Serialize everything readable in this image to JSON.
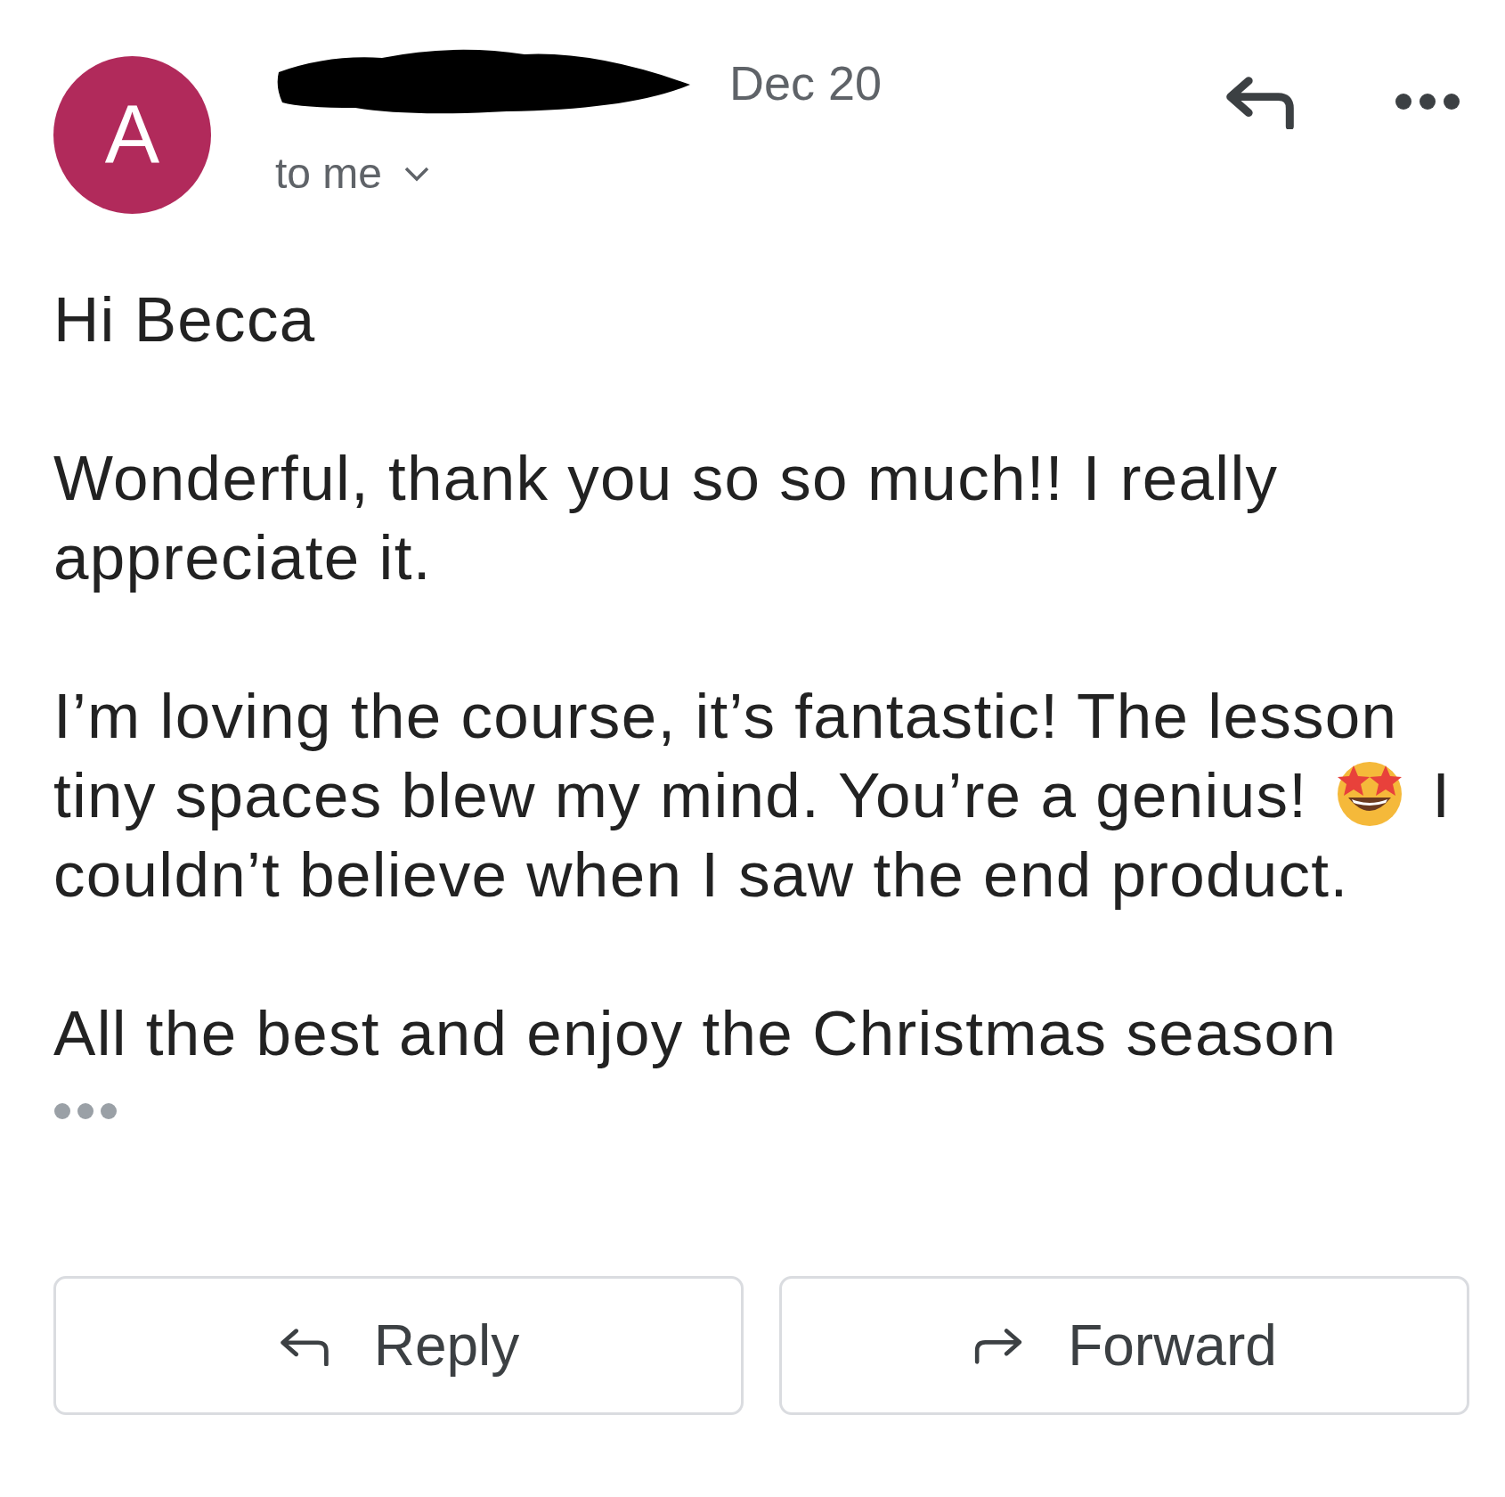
{
  "header": {
    "date": "Dec 20",
    "avatar_letter": "A",
    "recipient": "to me"
  },
  "body": {
    "greeting": "Hi Becca",
    "paragraphs": [
      {
        "segments": [
          {
            "kind": "text",
            "text": "Wonderful, thank you so so much!! I really"
          },
          {
            "kind": "break"
          },
          {
            "kind": "text",
            "text": "appreciate it."
          }
        ]
      },
      {
        "segments": [
          {
            "kind": "text",
            "text": "I’m loving the course, it’s fantastic! The lesson"
          },
          {
            "kind": "break"
          },
          {
            "kind": "text",
            "text": "tiny spaces blew my mind. You’re a genius!"
          },
          {
            "kind": "emoji"
          },
          {
            "kind": "text",
            "text": "I"
          },
          {
            "kind": "break"
          },
          {
            "kind": "text",
            "text": "couldn’t believe when I saw the end product."
          }
        ]
      },
      {
        "segments": [
          {
            "kind": "text",
            "text": "All the best and enjoy the Christmas season"
          }
        ]
      }
    ]
  },
  "actions": [
    {
      "kind": "reply",
      "label": "Reply"
    },
    {
      "kind": "forward",
      "label": "Forward"
    }
  ]
}
